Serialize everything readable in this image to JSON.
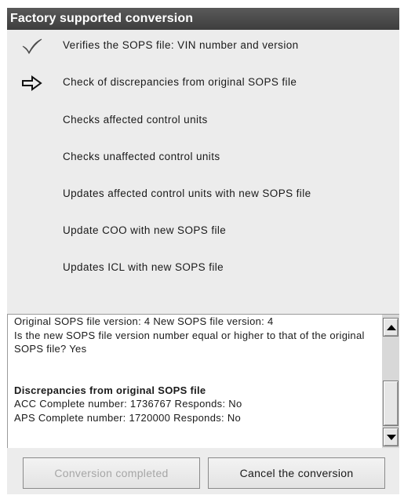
{
  "window": {
    "title": "Factory supported conversion"
  },
  "steps": [
    {
      "label": "Verifies the SOPS file: VIN number and version",
      "status": "done",
      "icon": "checkmark-icon"
    },
    {
      "label": "Check of discrepancies from original SOPS file",
      "status": "current",
      "icon": "arrow-right-icon"
    },
    {
      "label": "Checks affected control units",
      "status": "pending",
      "icon": ""
    },
    {
      "label": "Checks unaffected control units",
      "status": "pending",
      "icon": ""
    },
    {
      "label": "Updates affected control units with new SOPS file",
      "status": "pending",
      "icon": ""
    },
    {
      "label": "Update COO with new SOPS file",
      "status": "pending",
      "icon": ""
    },
    {
      "label": "Updates ICL with new SOPS file",
      "status": "pending",
      "icon": ""
    }
  ],
  "log": {
    "line1": "Original SOPS file version: 4 New SOPS file version: 4",
    "line2": "Is the new SOPS file version number equal or higher to that of the original SOPS file? Yes",
    "heading": "Discrepancies from original SOPS file",
    "line3": "ACC Complete number: 1736767 Responds: No",
    "line4": "APS Complete number: 1720000 Responds: No"
  },
  "buttons": {
    "completed_label": "Conversion completed",
    "completed_enabled": false,
    "cancel_label": "Cancel the conversion"
  },
  "colors": {
    "title_bar": "#4a4a4a",
    "window_bg": "#ececec",
    "disabled_text": "#a6a6a6"
  }
}
